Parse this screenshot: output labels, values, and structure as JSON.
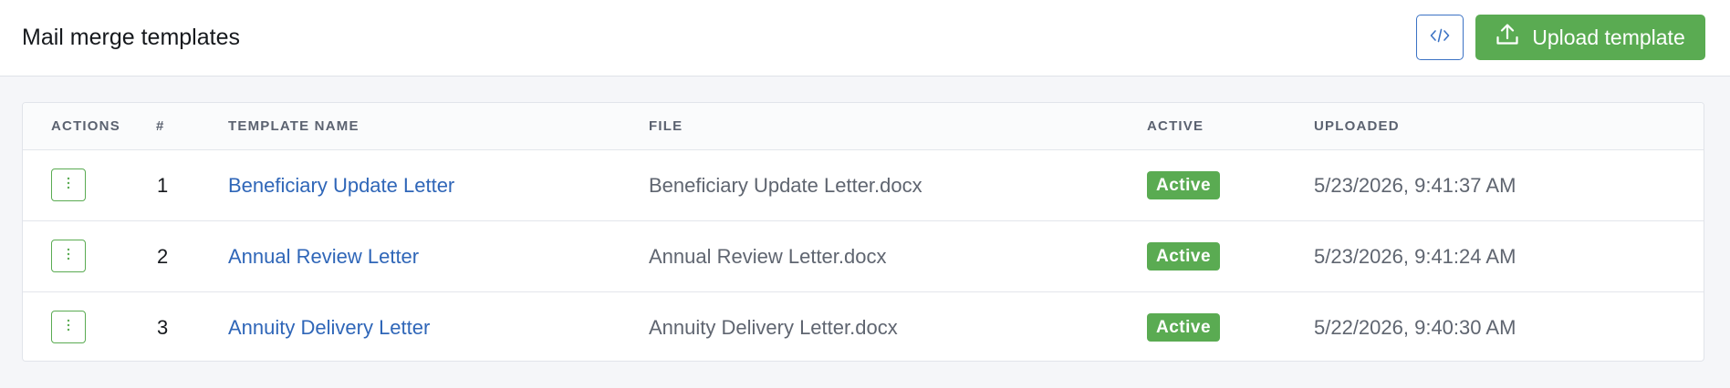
{
  "header": {
    "title": "Mail merge templates",
    "code_button_icon": "code-icon",
    "upload_button_icon": "upload-icon",
    "upload_label": "Upload template"
  },
  "colors": {
    "accent_green": "#5aab52",
    "link_blue": "#2f66b8",
    "border_blue": "#3b72c4"
  },
  "table": {
    "columns": [
      "ACTIONS",
      "#",
      "TEMPLATE NAME",
      "FILE",
      "ACTIVE",
      "UPLOADED"
    ],
    "rows": [
      {
        "actions_icon": "more-vertical-icon",
        "index": "1",
        "name": "Beneficiary Update Letter",
        "file": "Beneficiary Update Letter.docx",
        "active": "Active",
        "uploaded": "5/23/2026, 9:41:37 AM"
      },
      {
        "actions_icon": "more-vertical-icon",
        "index": "2",
        "name": "Annual Review Letter",
        "file": "Annual Review Letter.docx",
        "active": "Active",
        "uploaded": "5/23/2026, 9:41:24 AM"
      },
      {
        "actions_icon": "more-vertical-icon",
        "index": "3",
        "name": "Annuity Delivery Letter",
        "file": "Annuity Delivery Letter.docx",
        "active": "Active",
        "uploaded": "5/22/2026, 9:40:30 AM"
      }
    ]
  }
}
